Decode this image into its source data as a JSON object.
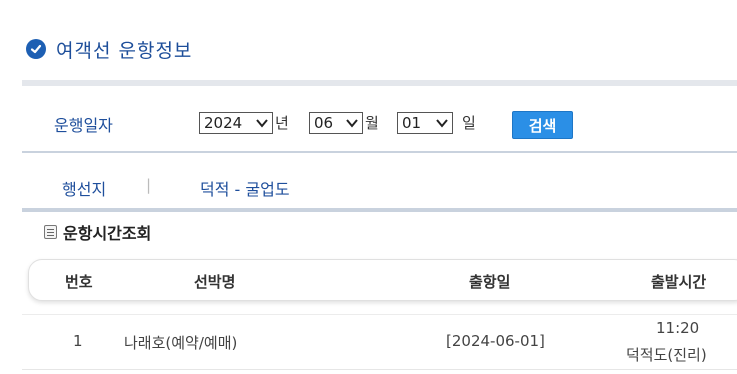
{
  "page": {
    "title": "여객선 운항정보"
  },
  "search": {
    "date_label": "운행일자",
    "year": "2024",
    "year_unit": "년",
    "month": "06",
    "month_unit": "월",
    "day": "01",
    "day_unit": "일",
    "search_button": "검색",
    "destination_label": "행선지",
    "separator": "|",
    "route": "덕적 - 굴업도"
  },
  "section": {
    "title": "운항시간조회"
  },
  "table": {
    "columns": [
      "번호",
      "선박명",
      "출항일",
      "출발시간"
    ],
    "rows": [
      {
        "no": "1",
        "ship": "나래호(예약/예매)",
        "date": "[2024-06-01]",
        "time": "11:20",
        "port": "덕적도(진리)"
      }
    ]
  },
  "colors": {
    "accent_blue": "#1d4e9a",
    "button_blue": "#2b8fe6",
    "divider": "#c9d2de"
  }
}
